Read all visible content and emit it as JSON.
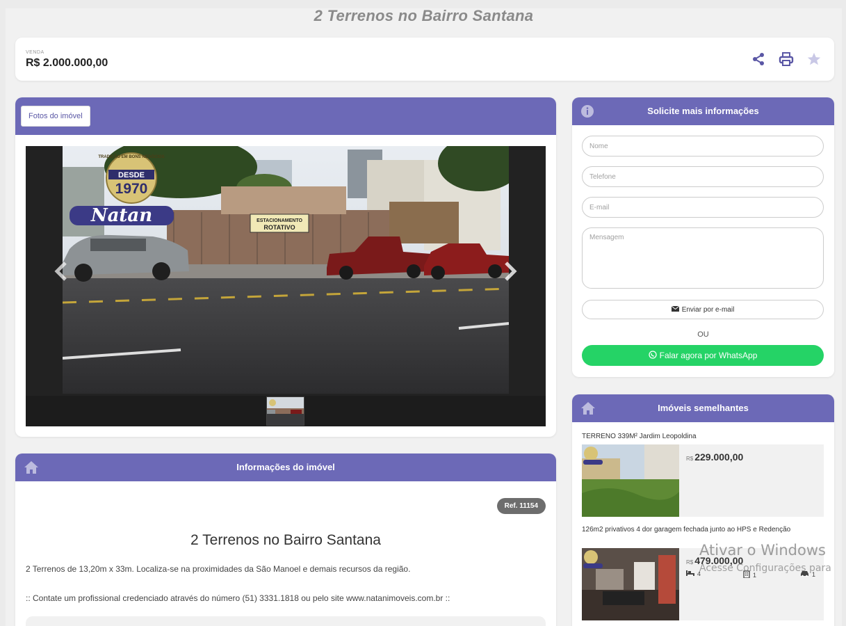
{
  "page": {
    "title": "2 Terrenos no Bairro Santana"
  },
  "price_bar": {
    "label": "VENDA",
    "value": "R$ 2.000.000,00"
  },
  "photos": {
    "button_label": "Fotos do imóvel",
    "photo_sign_top": "DESDE",
    "photo_sign_year": "1970",
    "photo_brand": "Natan",
    "photo_arc_text": "TRADIÇÃO EM BONS NEGÓCIOS",
    "parking_sign_top": "ESTACIONAMENTO",
    "parking_sign_bottom": "ROTATIVO"
  },
  "info": {
    "header": "Informações do imóvel",
    "ref": "Ref. 11154",
    "title": "2 Terrenos no Bairro Santana",
    "description": "2 Terrenos de 13,20m x 33m. Localiza-se na proximidades da São Manoel e demais recursos da região.",
    "contact": ":: Contate um profissional credenciado através do número (51) 3331.1818 ou pelo site www.natanimoveis.com.br ::"
  },
  "form": {
    "header": "Solicite mais informações",
    "name_placeholder": "Nome",
    "phone_placeholder": "Telefone",
    "email_placeholder": "E-mail",
    "message_placeholder": "Mensagem",
    "email_button": "Enviar por e-mail",
    "or_text": "OU",
    "whatsapp_button": "Falar agora por WhatsApp"
  },
  "similar": {
    "header": "Imóveis semelhantes",
    "items": [
      {
        "title": "TERRENO 339M² Jardim Leopoldina",
        "currency": "R$",
        "price": "229.000,00"
      },
      {
        "title": "126m2 privativos 4 dor garagem fechada junto ao HPS e Redenção",
        "currency": "R$",
        "price": "479.000,00",
        "bedrooms": "4",
        "bathrooms": "1",
        "garages": "1"
      }
    ]
  },
  "watermark": {
    "line1": "Ativar o Windows",
    "line2": "Acesse Configurações para"
  },
  "colors": {
    "accent": "#6c69b7",
    "whatsapp": "#25d366"
  }
}
